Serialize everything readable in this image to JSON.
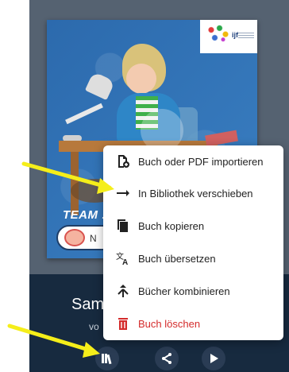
{
  "cover": {
    "logo_text": "ijf",
    "team_text": "TEAM :",
    "pill_text": "N"
  },
  "book": {
    "title_partial": "Sam",
    "subtitle_partial": "vo"
  },
  "menu": {
    "items": [
      {
        "label": "Buch oder PDF importieren",
        "icon": "file-plus-icon"
      },
      {
        "label": "In Bibliothek verschieben",
        "icon": "arrow-right-icon"
      },
      {
        "label": "Buch kopieren",
        "icon": "copy-icon"
      },
      {
        "label": "Buch übersetzen",
        "icon": "translate-icon"
      },
      {
        "label": "Bücher kombinieren",
        "icon": "merge-icon"
      },
      {
        "label": "Buch löschen",
        "icon": "trash-icon",
        "color": "#d42b2b"
      }
    ]
  },
  "toolbar": {
    "items": [
      {
        "icon": "library-icon"
      },
      {
        "icon": "share-icon"
      },
      {
        "icon": "play-icon"
      }
    ]
  },
  "colors": {
    "annotation_arrow": "#f5ee1a",
    "danger": "#d42b2b",
    "app_background": "#172a3f"
  }
}
